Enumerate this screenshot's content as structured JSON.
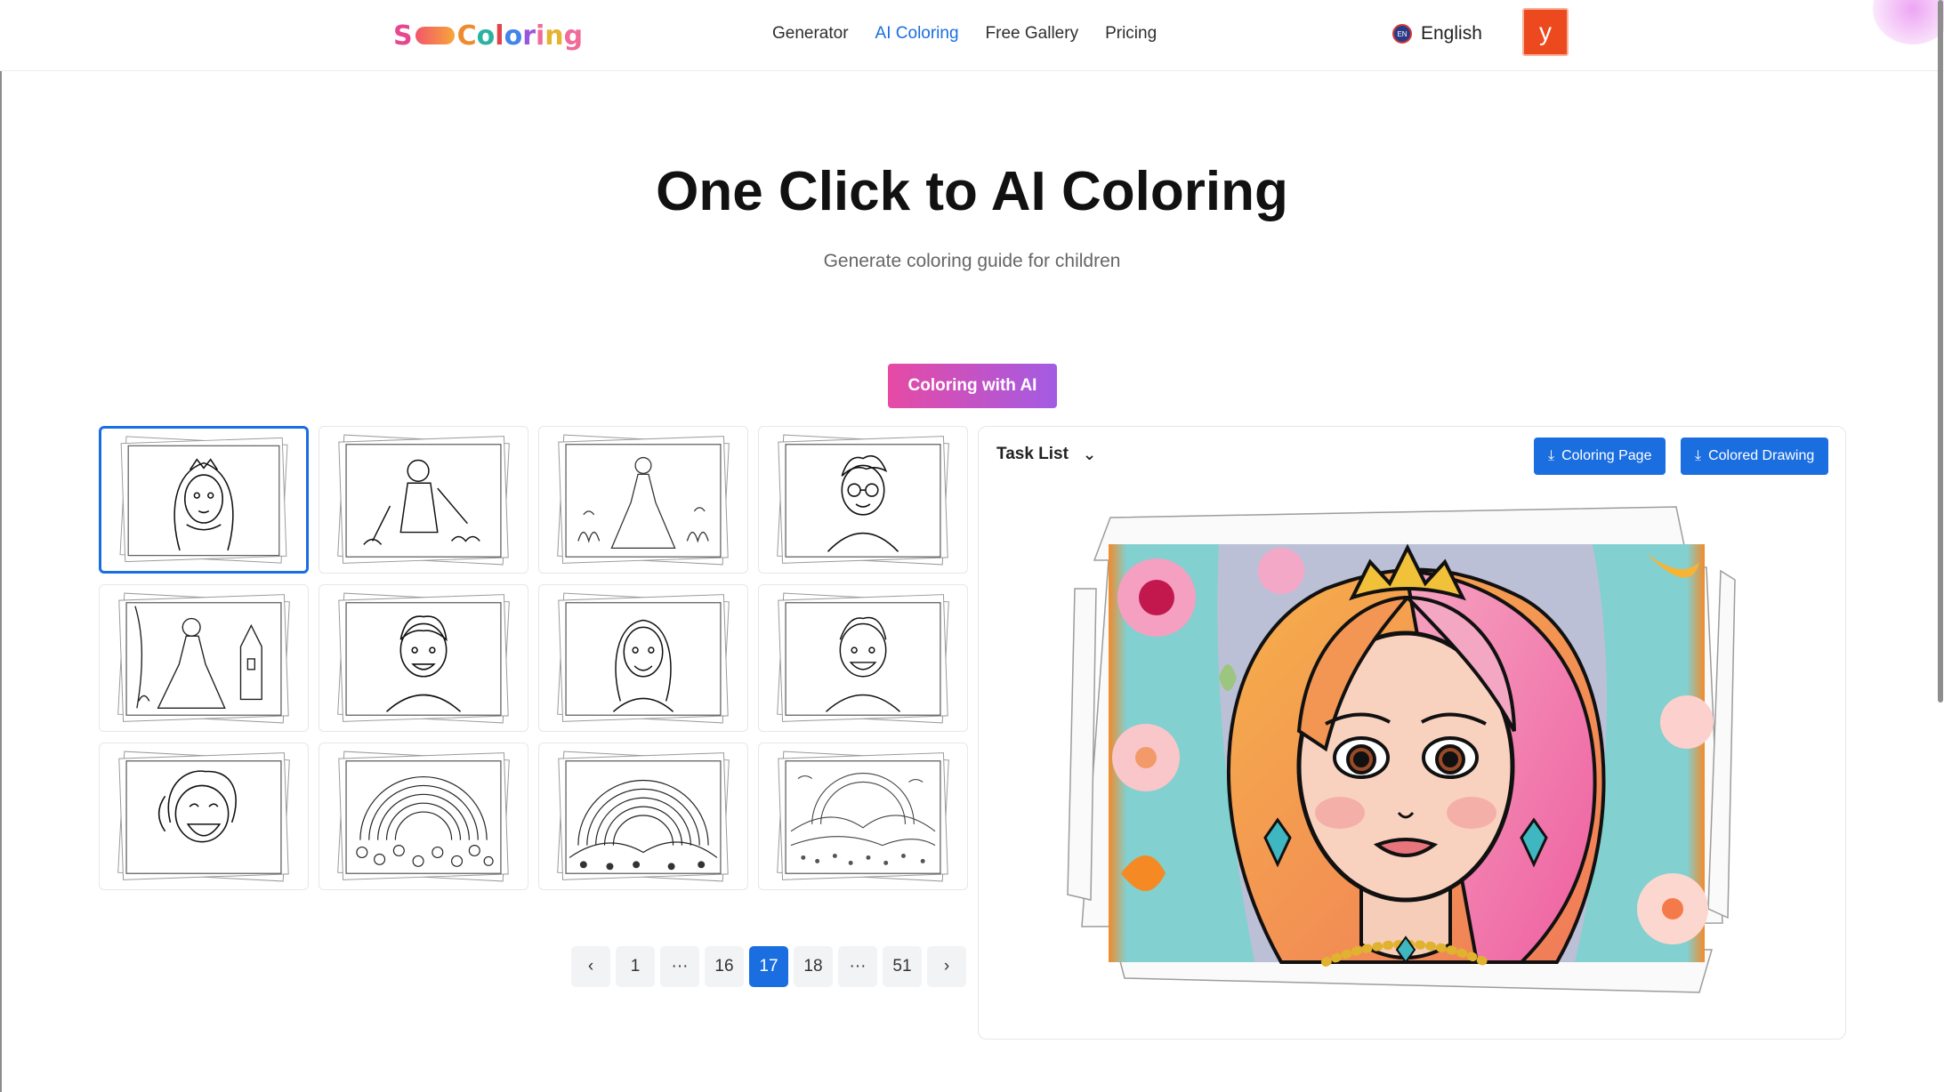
{
  "header": {
    "logo_text": "SoColoring",
    "nav": [
      {
        "label": "Generator",
        "active": false
      },
      {
        "label": "AI Coloring",
        "active": true
      },
      {
        "label": "Free Gallery",
        "active": false
      },
      {
        "label": "Pricing",
        "active": false
      }
    ],
    "language": {
      "flag_text": "EN",
      "label": "English"
    },
    "avatar_letter": "y",
    "accent_color": "#1a6ee0"
  },
  "hero": {
    "title": "One Click to AI Coloring",
    "subtitle": "Generate coloring guide for children",
    "cta_label": "Coloring with AI"
  },
  "gallery": {
    "selected_index": 0,
    "thumbnails": [
      {
        "subject": "princess portrait",
        "icon": "princess"
      },
      {
        "subject": "knight warrior",
        "icon": "knight"
      },
      {
        "subject": "princess in garden",
        "icon": "princess-full"
      },
      {
        "subject": "boy with glasses",
        "icon": "boy-glasses"
      },
      {
        "subject": "princess by castle",
        "icon": "princess-castle"
      },
      {
        "subject": "smiling boy",
        "icon": "boy"
      },
      {
        "subject": "smiling girl",
        "icon": "girl"
      },
      {
        "subject": "happy boy",
        "icon": "boy"
      },
      {
        "subject": "laughing girl",
        "icon": "girl-laugh"
      },
      {
        "subject": "rainbow with flowers",
        "icon": "rainbow"
      },
      {
        "subject": "rainbow over hills",
        "icon": "rainbow"
      },
      {
        "subject": "landscape with flowers",
        "icon": "landscape"
      }
    ]
  },
  "pagination": {
    "prev_icon": "‹",
    "next_icon": "›",
    "pages": [
      "1",
      "···",
      "16",
      "17",
      "18",
      "···",
      "51"
    ],
    "current": "17"
  },
  "panel": {
    "task_list_label": "Task List",
    "dropdown_icon": "⌄",
    "download_icon": "⤓",
    "coloring_page_label": "Coloring Page",
    "colored_drawing_label": "Colored Drawing",
    "preview_subject": "colored princess portrait"
  }
}
